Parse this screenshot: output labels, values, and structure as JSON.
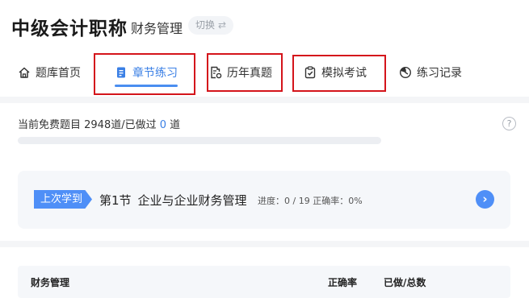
{
  "header": {
    "app_title": "中级会计职称",
    "subject": "财务管理",
    "switch_label": "切换",
    "switch_icon": "swap-icon"
  },
  "tabs": [
    {
      "label": "题库首页",
      "icon": "home-icon",
      "active": false
    },
    {
      "label": "章节练习",
      "icon": "document-icon",
      "active": true
    },
    {
      "label": "历年真题",
      "icon": "paper-settings-icon",
      "active": false
    },
    {
      "label": "模拟考试",
      "icon": "checklist-icon",
      "active": false
    },
    {
      "label": "练习记录",
      "icon": "clock-chart-icon",
      "active": false
    }
  ],
  "free_info": {
    "prefix": "当前免费题目 2948道/已做过 ",
    "done_count": "0",
    "suffix": " 道",
    "progress": 0,
    "help_glyph": "?"
  },
  "last_study": {
    "tag": "上次学到",
    "section_no": "第1节",
    "section_title": "企业与企业财务管理",
    "stats": "进度：0 / 19  正确率：0%"
  },
  "list_header": {
    "name": "财务管理",
    "accuracy": "正确率",
    "done_total": "已做/总数"
  },
  "colors": {
    "accent": "#4a8ef0",
    "highlight_box": "#d4141b"
  }
}
